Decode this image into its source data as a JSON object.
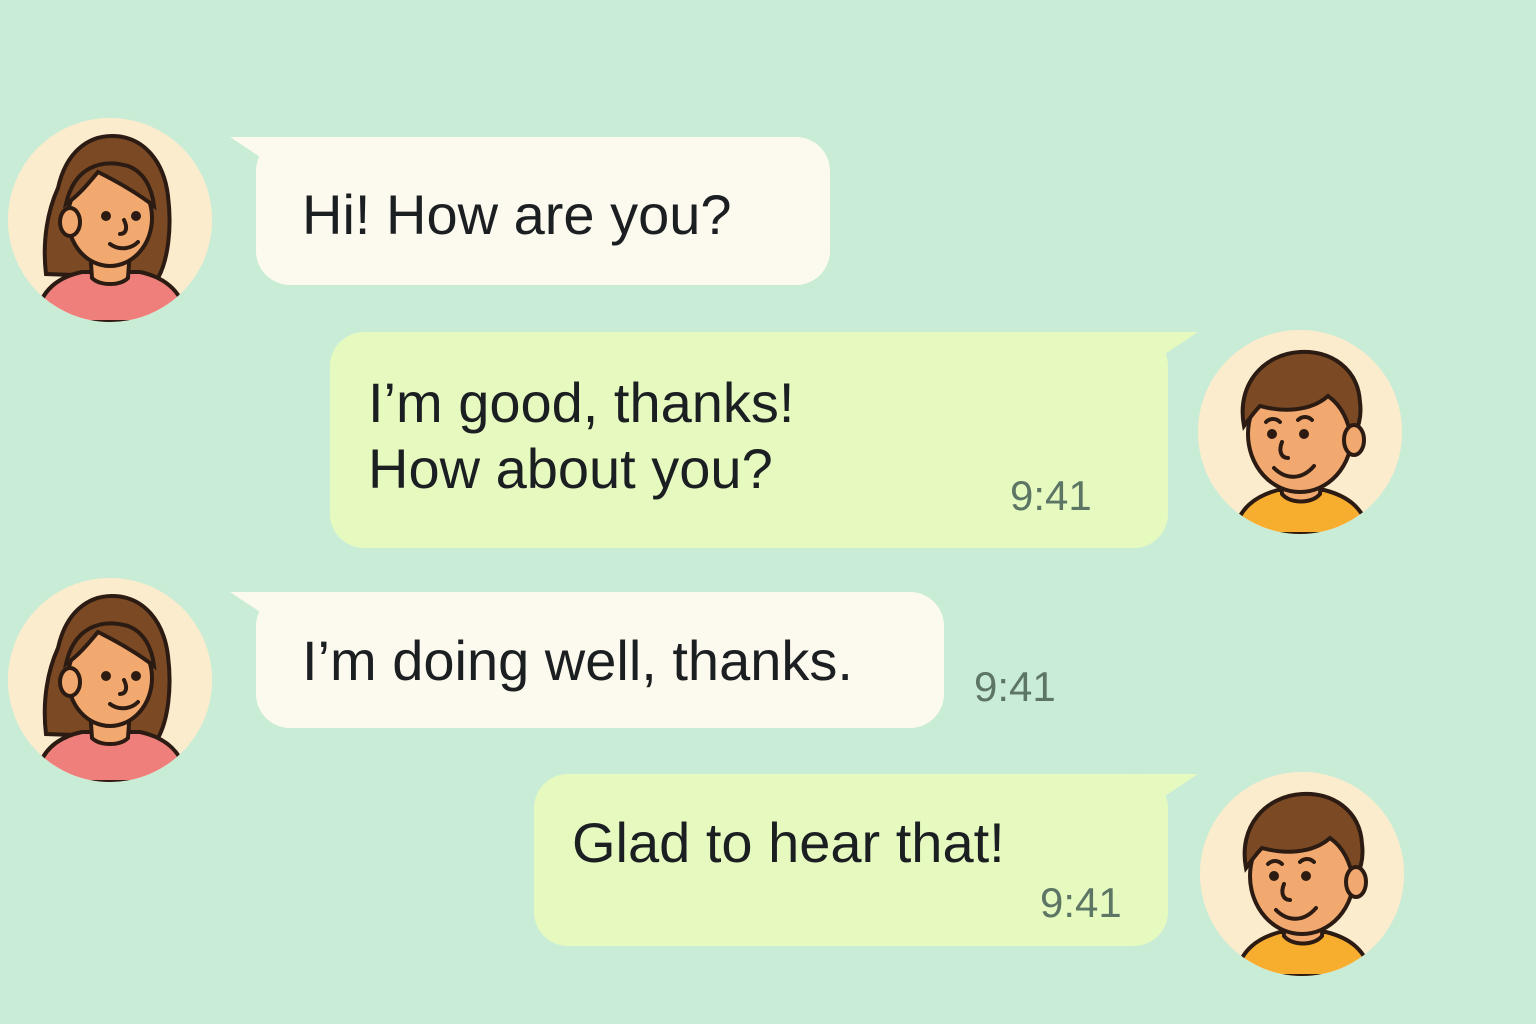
{
  "conversation": {
    "messages": [
      {
        "sender": "girl",
        "direction": "incoming",
        "text": "Hi! How are you?",
        "time": "",
        "avatar_icon": "girl-avatar-icon"
      },
      {
        "sender": "boy",
        "direction": "outgoing",
        "text": "I’m good, thanks!\nHow about you?",
        "time": "9:41",
        "avatar_icon": "boy-avatar-icon"
      },
      {
        "sender": "girl",
        "direction": "incoming",
        "text": "I’m doing well, thanks.",
        "time": "9:41",
        "avatar_icon": "girl-avatar-icon"
      },
      {
        "sender": "boy",
        "direction": "outgoing",
        "text": "Glad to hear that!",
        "time": "9:41",
        "avatar_icon": "boy-avatar-icon"
      }
    ]
  },
  "colors": {
    "background": "#c9ecd7",
    "incoming_bubble": "#fcfaee",
    "outgoing_bubble": "#e6fac0",
    "timestamp": "#5d7564",
    "avatar_background": "#faeccc",
    "girl_shirt": "#ef7f7b",
    "boy_shirt": "#f7ad2e",
    "hair": "#7b4a24",
    "skin": "#f2a96f"
  }
}
